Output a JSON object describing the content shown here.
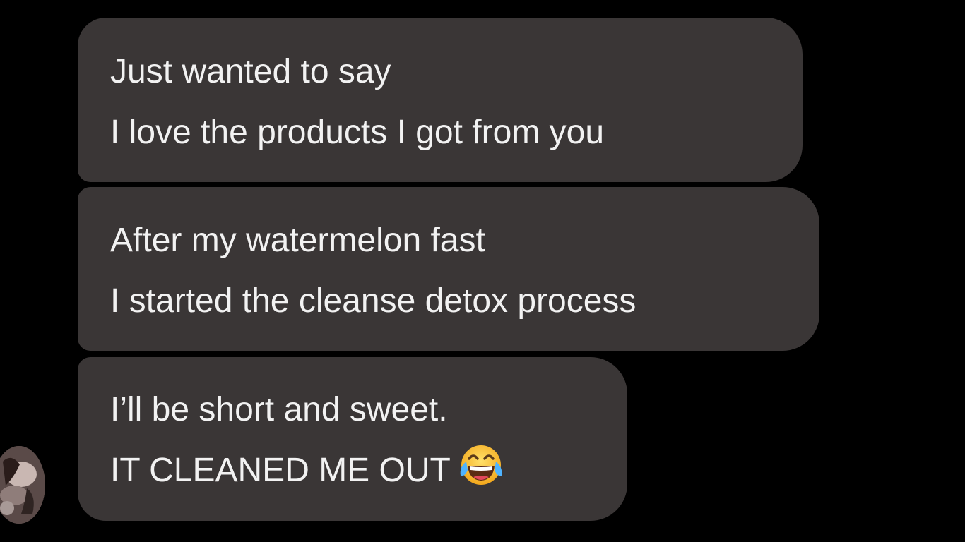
{
  "conversation": {
    "messages": [
      {
        "lines": [
          "Just wanted to say",
          "I love the products I got from you"
        ]
      },
      {
        "lines": [
          "After my watermelon fast",
          "I started the cleanse detox process"
        ]
      },
      {
        "lines": [
          "I’ll be short and sweet.",
          "IT CLEANED ME OUT"
        ],
        "emoji": "face-with-tears-of-joy"
      }
    ],
    "sender_avatar": "avatar-image"
  },
  "colors": {
    "background": "#000000",
    "bubble": "#3a3636",
    "text": "#f2f2f2"
  }
}
